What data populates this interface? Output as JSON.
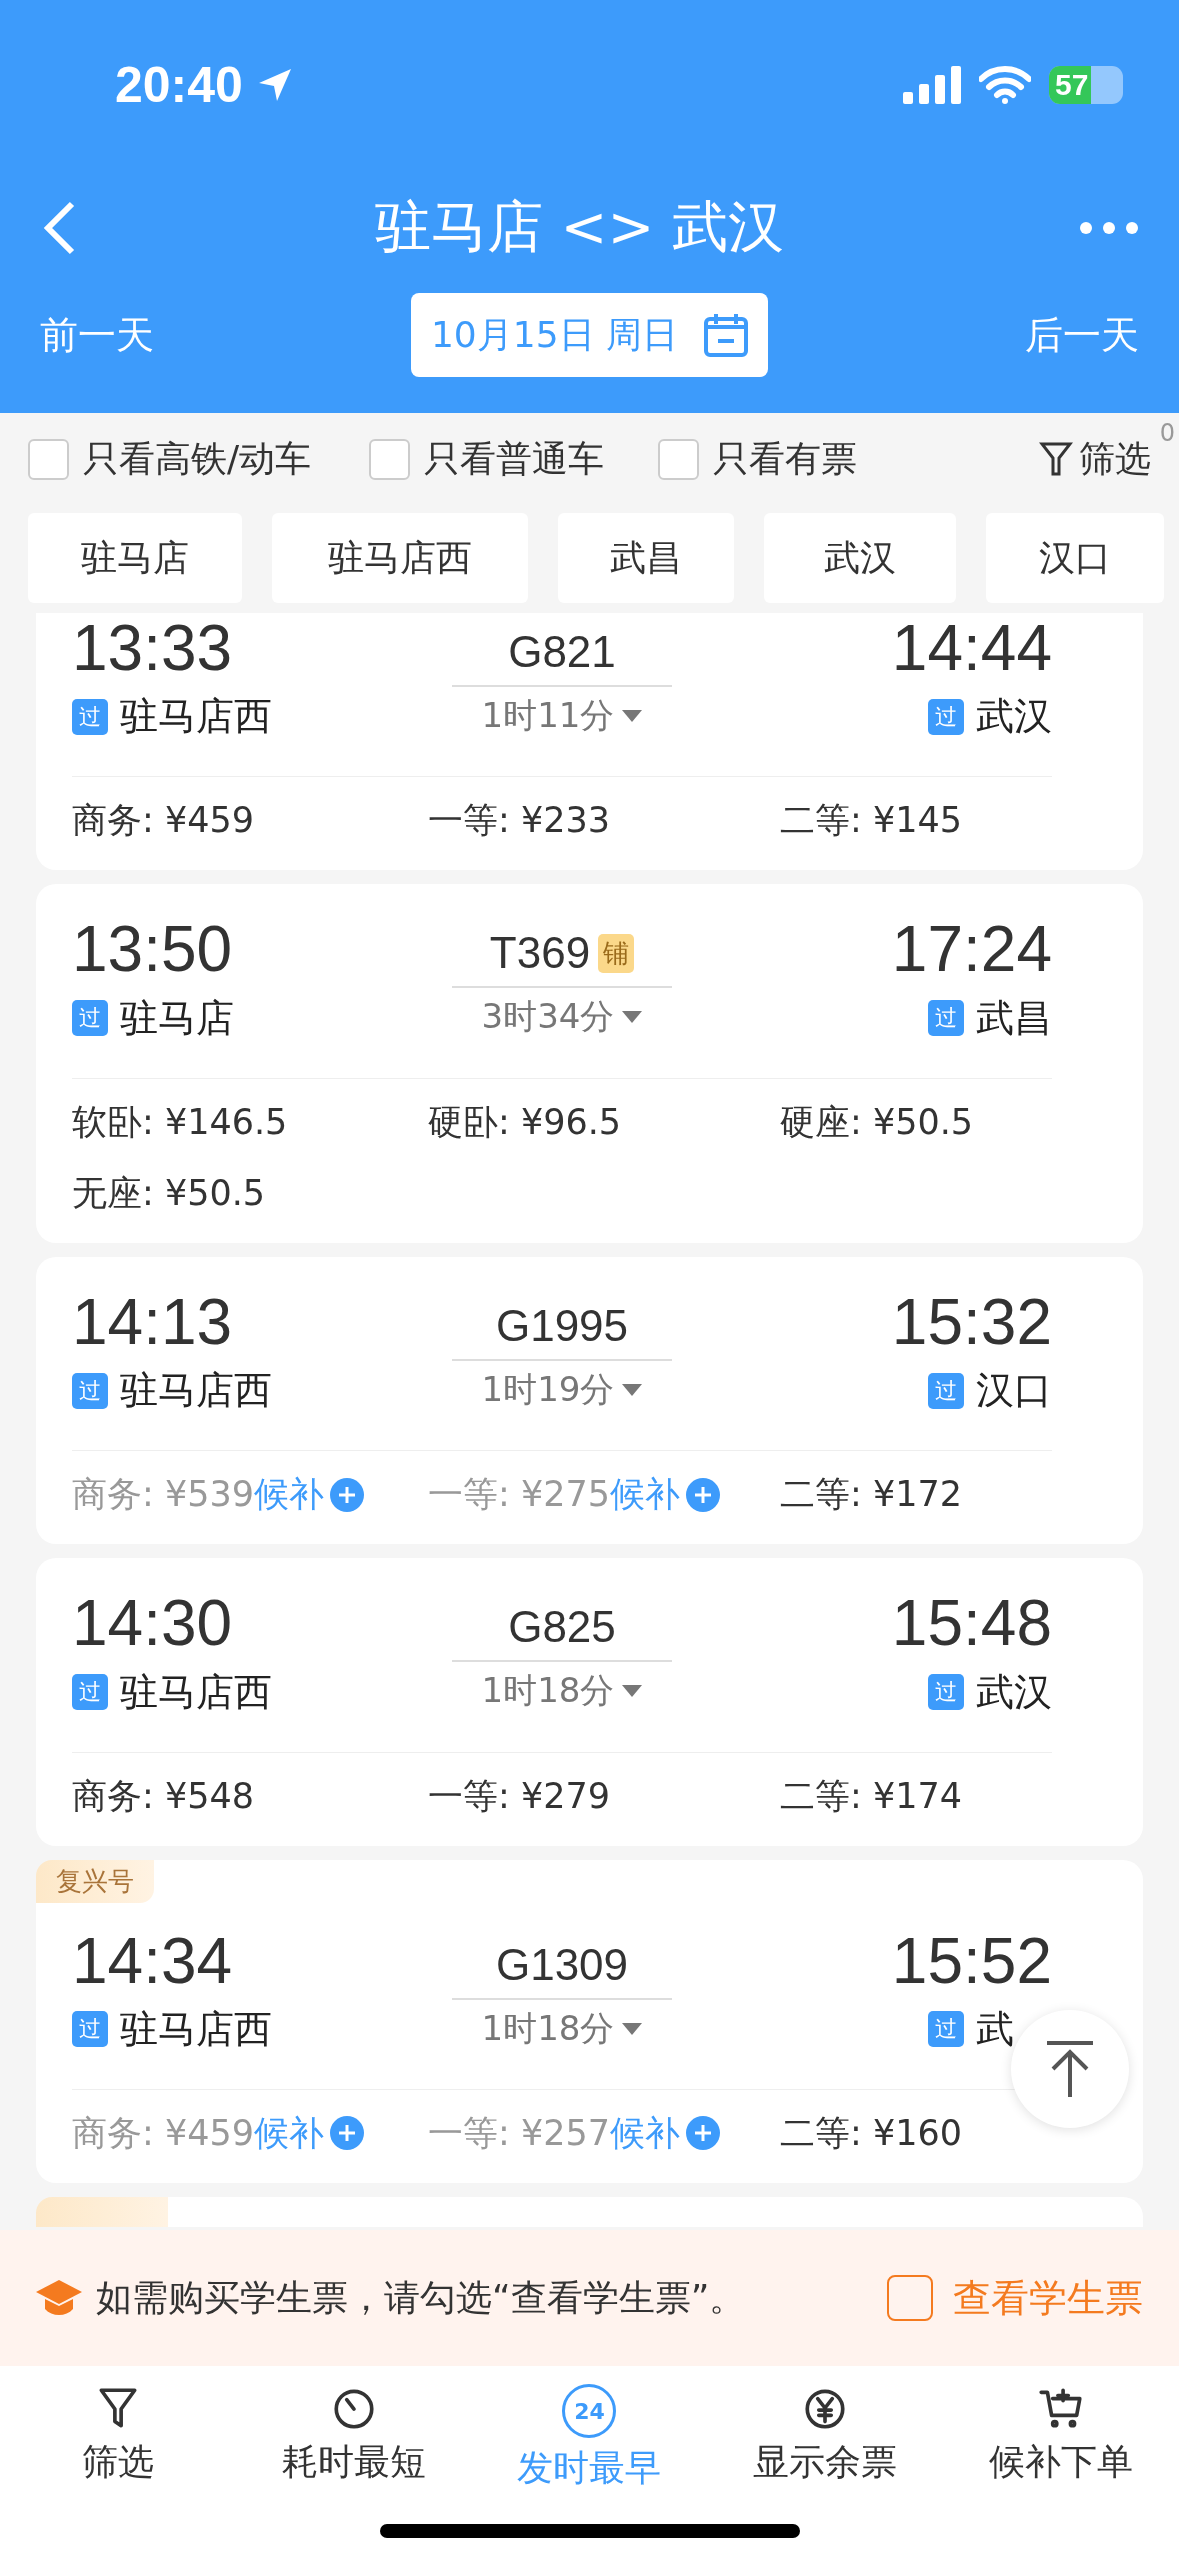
{
  "status_bar": {
    "time": "20:40",
    "battery": "57"
  },
  "nav": {
    "title": "驻马店 <> 武汉"
  },
  "date_bar": {
    "prev": "前一天",
    "date": "10月15日 周日",
    "next": "后一天"
  },
  "filters": [
    {
      "label": "只看高铁/动车",
      "checked": false
    },
    {
      "label": "只看普通车",
      "checked": false
    },
    {
      "label": "只看有票",
      "checked": false
    }
  ],
  "filter_button": {
    "label": "筛选",
    "count": "0"
  },
  "stations": [
    {
      "label": "驻马店",
      "selected": false
    },
    {
      "label": "驻马店西",
      "selected": false
    },
    {
      "label": "武昌",
      "selected": false
    },
    {
      "label": "武汉",
      "selected": false
    },
    {
      "label": "汉口",
      "selected": false
    }
  ],
  "trains": [
    {
      "depart_time": "13:33",
      "depart_tag": "过",
      "depart_station": "驻马店西",
      "train_no": "G821",
      "duration": "1时11分",
      "arrive_time": "14:44",
      "arrive_tag": "过",
      "arrive_station": "武汉",
      "seats": [
        {
          "text": "商务: ¥459",
          "available": true
        },
        {
          "text": "一等: ¥233",
          "available": true
        },
        {
          "text": "二等: ¥145",
          "available": true
        }
      ]
    },
    {
      "depart_time": "13:50",
      "depart_tag": "过",
      "depart_station": "驻马店",
      "train_no": "T369",
      "train_tag": "铺",
      "duration": "3时34分",
      "arrive_time": "17:24",
      "arrive_tag": "过",
      "arrive_station": "武昌",
      "seats": [
        {
          "text": "软卧: ¥146.5",
          "available": true
        },
        {
          "text": "硬卧: ¥96.5",
          "available": true
        },
        {
          "text": "硬座: ¥50.5",
          "available": true
        },
        {
          "text": "无座: ¥50.5",
          "available": true
        }
      ]
    },
    {
      "depart_time": "14:13",
      "depart_tag": "过",
      "depart_station": "驻马店西",
      "train_no": "G1995",
      "duration": "1时19分",
      "arrive_time": "15:32",
      "arrive_tag": "过",
      "arrive_station": "汉口",
      "seats": [
        {
          "text": "商务: ¥539",
          "available": false,
          "waitlist": "候补"
        },
        {
          "text": "一等: ¥275",
          "available": false,
          "waitlist": "候补"
        },
        {
          "text": "二等: ¥172",
          "available": true
        }
      ]
    },
    {
      "depart_time": "14:30",
      "depart_tag": "过",
      "depart_station": "驻马店西",
      "train_no": "G825",
      "duration": "1时18分",
      "arrive_time": "15:48",
      "arrive_tag": "过",
      "arrive_station": "武汉",
      "seats": [
        {
          "text": "商务: ¥548",
          "available": true
        },
        {
          "text": "一等: ¥279",
          "available": true
        },
        {
          "text": "二等: ¥174",
          "available": true
        }
      ]
    },
    {
      "badge": "复兴号",
      "depart_time": "14:34",
      "depart_tag": "过",
      "depart_station": "驻马店西",
      "train_no": "G1309",
      "duration": "1时18分",
      "arrive_time": "15:52",
      "arrive_tag": "过",
      "arrive_station": "武",
      "seats": [
        {
          "text": "商务: ¥459",
          "available": false,
          "waitlist": "候补"
        },
        {
          "text": "一等: ¥257",
          "available": false,
          "waitlist": "候补"
        },
        {
          "text": "二等: ¥160",
          "available": true
        }
      ]
    }
  ],
  "notice": {
    "text": "如需购买学生票，请勾选“查看学生票”。",
    "checkbox_label": "查看学生票",
    "checked": false
  },
  "bottom_tabs": [
    {
      "label": "筛选",
      "selected": false
    },
    {
      "label": "耗时最短",
      "selected": false
    },
    {
      "label": "发时最早",
      "selected": true,
      "icon_text": "24"
    },
    {
      "label": "显示余票",
      "selected": false
    },
    {
      "label": "候补下单",
      "selected": false
    }
  ]
}
